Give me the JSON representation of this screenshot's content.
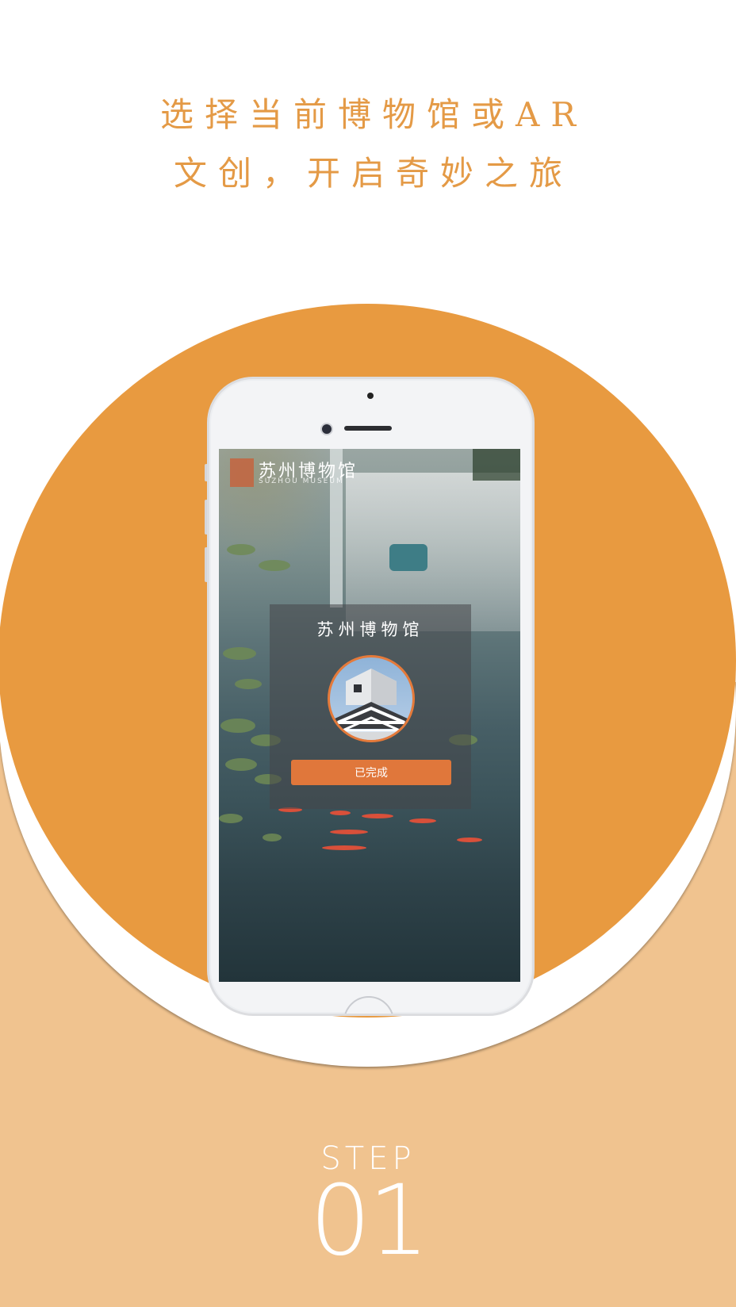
{
  "headline": {
    "line1": "选择当前博物馆或AR",
    "line2": "文创，开启奇妙之旅"
  },
  "app_screen": {
    "logo_title": "苏州博物馆",
    "logo_subtitle": "SUZHOU MUSEUM",
    "card_title": "苏州博物馆",
    "done_button": "已完成"
  },
  "step": {
    "label": "STEP",
    "number": "01"
  },
  "colors": {
    "accent_orange": "#e89a40",
    "bottom_panel": "#f0c38f",
    "button_orange": "#e0773b",
    "headline_text": "#e49a46"
  }
}
